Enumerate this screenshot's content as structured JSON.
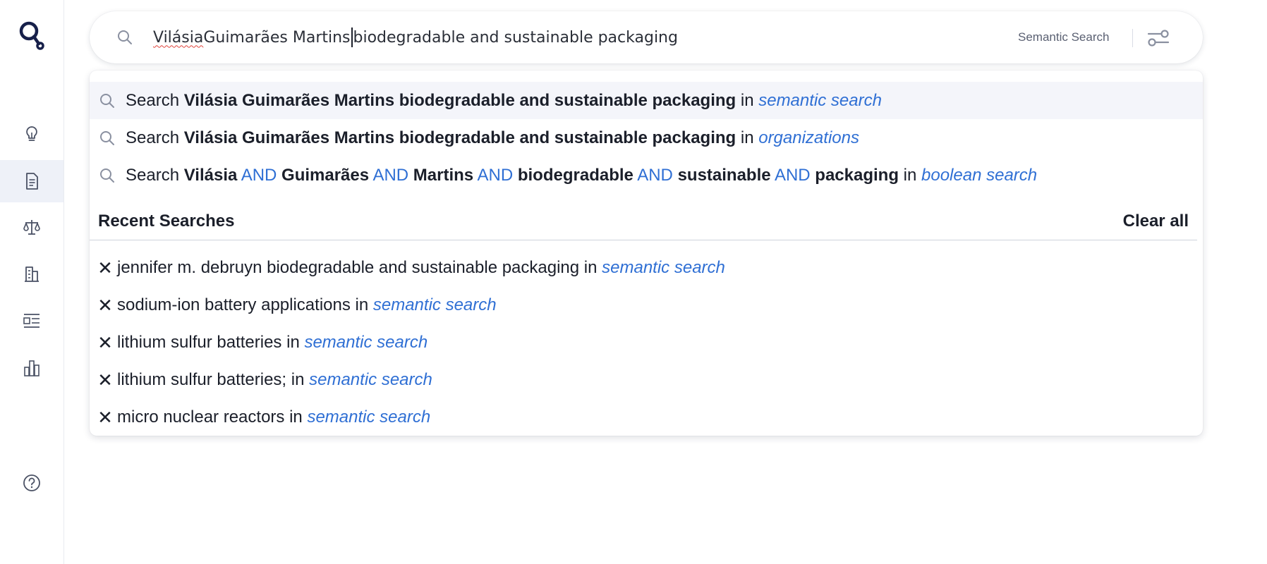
{
  "search": {
    "query_misspelled": "Vilásia",
    "query_after_misspelled": " Guimarães Martins",
    "query_after_caret": " biodegradable and sustainable packaging",
    "mode_label": "Semantic Search"
  },
  "suggestions": [
    {
      "prefix": "Search ",
      "query": "Vilásia Guimarães Martins biodegradable and sustainable packaging",
      "in_word": " in ",
      "scope": "semantic search"
    },
    {
      "prefix": "Search ",
      "query": "Vilásia Guimarães Martins biodegradable and sustainable packaging",
      "in_word": " in ",
      "scope": "organizations"
    },
    {
      "prefix": "Search ",
      "terms": [
        "Vilásia",
        "Guimarães",
        "Martins",
        "biodegradable",
        "sustainable",
        "packaging"
      ],
      "operator": "AND",
      "in_word": " in ",
      "scope": "boolean search"
    }
  ],
  "recent": {
    "title": "Recent Searches",
    "clear_label": "Clear all",
    "remove_glyph": "✕",
    "in_word": " in ",
    "items": [
      {
        "query": "jennifer m. debruyn biodegradable and sustainable packaging",
        "scope": "semantic search"
      },
      {
        "query": "sodium-ion battery applications",
        "scope": "semantic search"
      },
      {
        "query": "lithium sulfur batteries",
        "scope": "semantic search"
      },
      {
        "query": "lithium sulfur batteries;",
        "scope": "semantic search"
      },
      {
        "query": "micro nuclear reactors",
        "scope": "semantic search"
      }
    ]
  },
  "sidebar": {
    "items": [
      {
        "icon": "lightbulb-icon",
        "name": "sidebar-item-insights",
        "active": false
      },
      {
        "icon": "document-icon",
        "name": "sidebar-item-documents",
        "active": true
      },
      {
        "icon": "scales-icon",
        "name": "sidebar-item-legal",
        "active": false
      },
      {
        "icon": "building-icon",
        "name": "sidebar-item-organizations",
        "active": false
      },
      {
        "icon": "list-icon",
        "name": "sidebar-item-lists",
        "active": false
      },
      {
        "icon": "bar-chart-icon",
        "name": "sidebar-item-analytics",
        "active": false
      }
    ],
    "help_icon": "help-icon"
  },
  "colors": {
    "accent": "#2f6fd4",
    "text": "#1b1f2a",
    "icon": "#4a5164",
    "highlight": "#f4f5fa",
    "active_nav": "#eef1f8"
  }
}
